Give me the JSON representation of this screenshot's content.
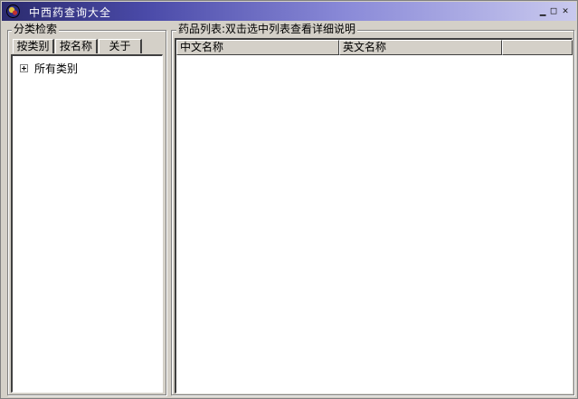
{
  "window": {
    "title": "中西药查询大全",
    "min_glyph": "▁",
    "max_glyph": "□",
    "close_glyph": "✕"
  },
  "left_panel": {
    "group_label": "分类检索",
    "tabs": [
      {
        "label": "按类别"
      },
      {
        "label": "按名称"
      },
      {
        "label": "关于"
      }
    ],
    "tree": [
      {
        "label": "所有类别",
        "expandable": true
      }
    ]
  },
  "right_panel": {
    "group_label": "药品列表:双击选中列表查看详细说明",
    "columns": [
      {
        "label": "中文名称"
      },
      {
        "label": "英文名称"
      },
      {
        "label": ""
      }
    ],
    "rows": []
  }
}
